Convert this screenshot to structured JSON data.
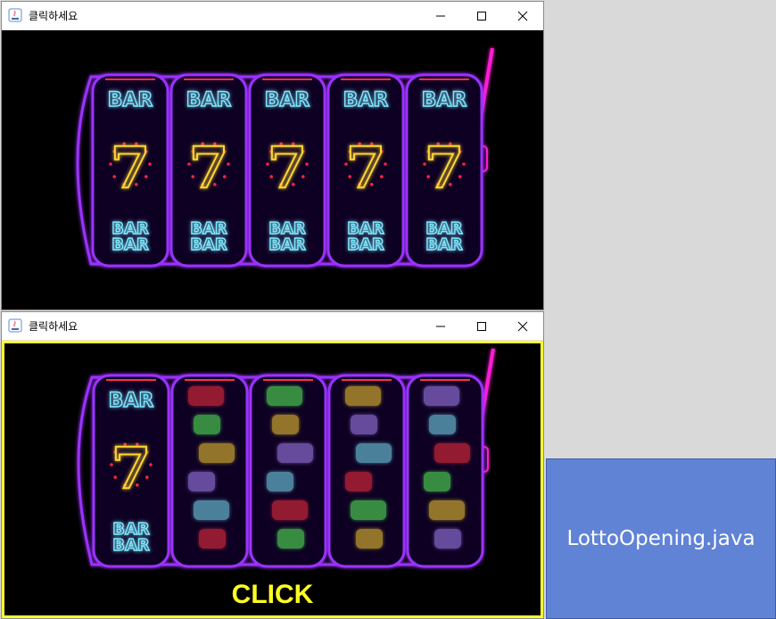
{
  "window1": {
    "title": "클릭하세요"
  },
  "window2": {
    "title": "클릭하세요",
    "click_label": "CLICK"
  },
  "reel_text": {
    "bar": "BAR",
    "seven": "7"
  },
  "file_badge": {
    "label": "LottoOpening.java"
  },
  "colors": {
    "neon_purple": "#9b30ff",
    "neon_magenta": "#ff1fd6",
    "neon_cyan": "#7fe9ff",
    "neon_yellow": "#ffd633",
    "highlight_border": "#ffff33",
    "badge_bg": "#6083d6"
  },
  "icons": [
    "java-icon",
    "minimize-icon",
    "maximize-icon",
    "close-icon"
  ]
}
